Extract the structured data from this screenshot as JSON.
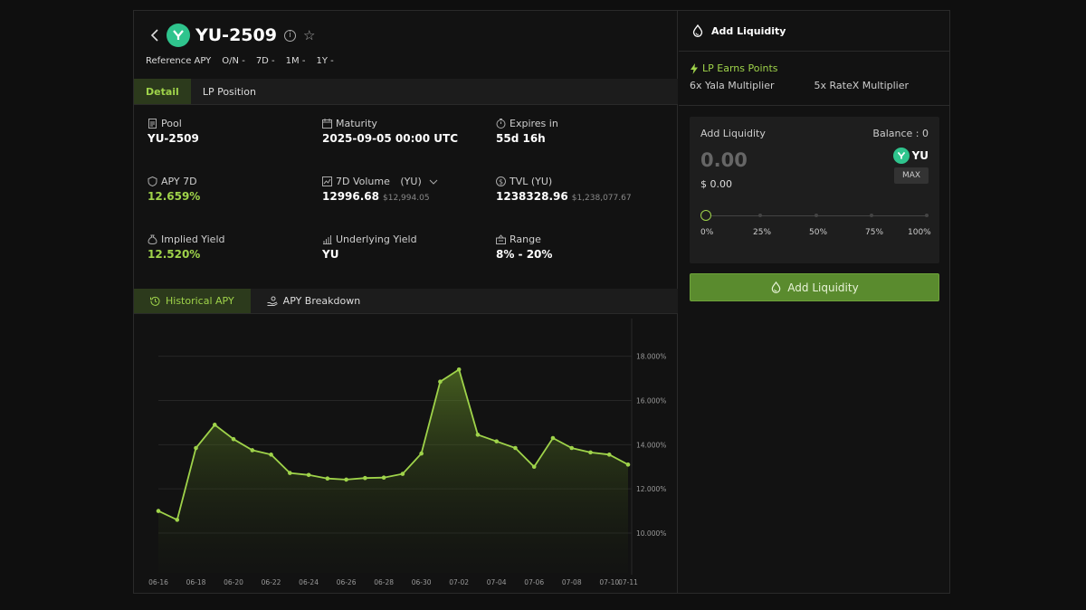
{
  "header": {
    "title": "YU-2509",
    "reference_label": "Reference APY",
    "periods": [
      "O/N -",
      "7D -",
      "1M -",
      "1Y -"
    ]
  },
  "detail_tabs": [
    "Detail",
    "LP Position"
  ],
  "stats": {
    "pool": {
      "label": "Pool",
      "value": "YU-2509"
    },
    "maturity": {
      "label": "Maturity",
      "value": "2025-09-05 00:00 UTC"
    },
    "expires": {
      "label": "Expires in",
      "value": "55d 16h"
    },
    "apy7d": {
      "label": "APY 7D",
      "value": "12.659%"
    },
    "volume": {
      "label": "7D Volume",
      "unit": "(YU)",
      "value": "12996.68",
      "sub": "$12,994.05"
    },
    "tvl": {
      "label": "TVL (YU)",
      "value": "1238328.96",
      "sub": "$1,238,077.67"
    },
    "implied": {
      "label": "Implied Yield",
      "value": "12.520%"
    },
    "underlying": {
      "label": "Underlying Yield",
      "value": "YU"
    },
    "range": {
      "label": "Range",
      "value": "8% - 20%"
    }
  },
  "chart_tabs": [
    "Historical APY",
    "APY Breakdown"
  ],
  "chart_data": {
    "type": "area",
    "x": [
      "06-16",
      "06-17",
      "06-18",
      "06-19",
      "06-20",
      "06-21",
      "06-22",
      "06-23",
      "06-24",
      "06-25",
      "06-26",
      "06-27",
      "06-28",
      "06-29",
      "06-30",
      "07-01",
      "07-02",
      "07-03",
      "07-04",
      "07-05",
      "07-06",
      "07-07",
      "07-08",
      "07-09",
      "07-10",
      "07-11"
    ],
    "values": [
      11.0,
      10.6,
      13.85,
      14.9,
      14.25,
      13.75,
      13.55,
      12.72,
      12.63,
      12.47,
      12.42,
      12.49,
      12.51,
      12.68,
      13.6,
      16.85,
      17.4,
      14.45,
      14.15,
      13.85,
      13.0,
      14.3,
      13.85,
      13.65,
      13.55,
      13.1
    ],
    "xticks": [
      "06-16",
      "06-18",
      "06-20",
      "06-22",
      "06-24",
      "06-26",
      "06-28",
      "06-30",
      "07-02",
      "07-04",
      "07-06",
      "07-08",
      "07-10",
      "07-11"
    ],
    "yticks": [
      "10.000%",
      "12.000%",
      "14.000%",
      "16.000%",
      "18.000%"
    ],
    "ylim": [
      8.2,
      19.5
    ],
    "color": "#9fd34a"
  },
  "side": {
    "title": "Add Liquidity",
    "earn_title": "LP Earns Points",
    "mult1": "6x Yala Multiplier",
    "mult2": "5x RateX Multiplier",
    "input_label": "Add Liquidity",
    "balance": "Balance : 0",
    "amount": "0.00",
    "usd": "$ 0.00",
    "token": "YU",
    "max": "MAX",
    "pcts": [
      "0%",
      "25%",
      "50%",
      "75%",
      "100%"
    ],
    "button": "Add Liquidity"
  }
}
